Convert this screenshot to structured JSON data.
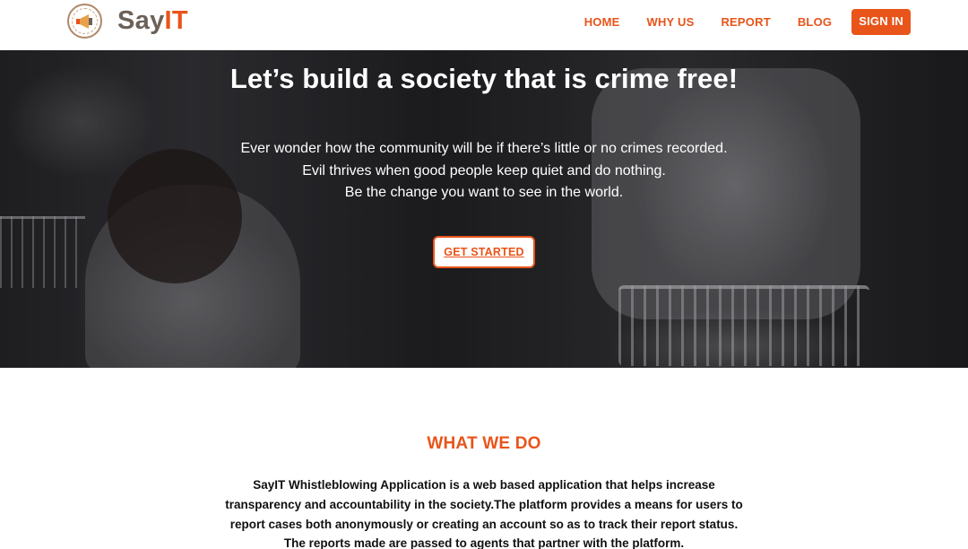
{
  "brand": {
    "say": "Say",
    "it": "IT",
    "accent_color": "#e8541a",
    "dark_color": "#6b6158"
  },
  "nav": {
    "items": [
      "HOME",
      "WHY US",
      "REPORT",
      "BLOG"
    ],
    "signin": "SIGN IN"
  },
  "hero": {
    "title": "Let’s build a society that is crime free!",
    "lines": [
      "Ever wonder how the community will be if there’s little or no crimes recorded.",
      "Evil thrives when good people keep quiet and do nothing.",
      "Be the change you want to see in the world."
    ],
    "cta": "GET STARTED"
  },
  "what_we_do": {
    "title": "WHAT WE DO",
    "lines": [
      "SayIT Whistleblowing Application is a web based application that helps increase",
      "transparency and accountability in the society.The platform provides a means for users to",
      "report cases both anonymously or creating an account so as to track their report status.",
      "The reports made are passed to agents that partner with the platform."
    ]
  },
  "icons": {
    "logo": "megaphone-logo-icon"
  }
}
